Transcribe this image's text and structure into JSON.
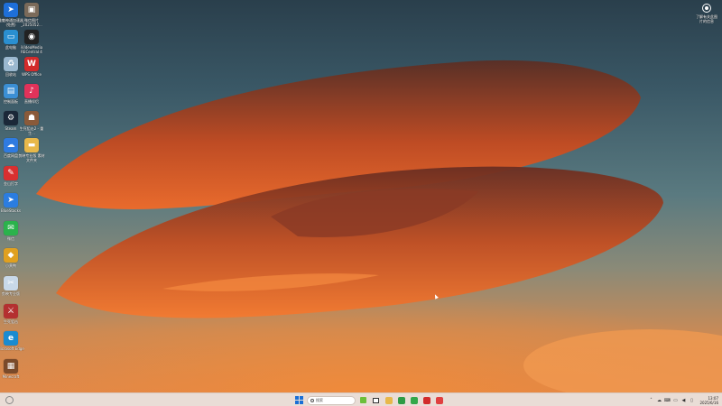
{
  "desktop": {
    "icons": [
      {
        "label": "维魅神通加速器(免费)",
        "icon": "speedup-icon",
        "color": "#1e6fd9",
        "glyph": "➤"
      },
      {
        "label": "微信图片_2025052...",
        "icon": "photo-file-icon",
        "color": "#7a6a5a",
        "glyph": "▣"
      },
      {
        "label": "此电脑",
        "icon": "computer-icon",
        "color": "#2a8fd0",
        "glyph": "▭"
      },
      {
        "label": "iVideoMedia RECentral 4",
        "icon": "recorder-icon",
        "color": "#222222",
        "glyph": "◉"
      },
      {
        "label": "回收站",
        "icon": "recycle-bin-icon",
        "color": "#9ab8cf",
        "glyph": "♻"
      },
      {
        "label": "WPS Office",
        "icon": "wps-icon",
        "color": "#d22b2b",
        "glyph": "W"
      },
      {
        "label": "控制面板",
        "icon": "control-panel-icon",
        "color": "#3b8fd4",
        "glyph": "▤"
      },
      {
        "label": "直播伴侣",
        "icon": "live-companion-icon",
        "color": "#e0325a",
        "glyph": "♪"
      },
      {
        "label": "Steam",
        "icon": "steam-icon",
        "color": "#1b2838",
        "glyph": "⚙"
      },
      {
        "label": "生死狙击2 - 重生...",
        "icon": "game-icon",
        "color": "#8a5a3a",
        "glyph": "☗"
      },
      {
        "label": "百度网盘",
        "icon": "cloud-disk-icon",
        "color": "#2f7be0",
        "glyph": "☁"
      },
      {
        "label": "剪映专业版 素材文件夹",
        "icon": "folder-icon",
        "color": "#e8b84a",
        "glyph": "▬"
      },
      {
        "label": "金山打字",
        "icon": "typing-icon",
        "color": "#d83030",
        "glyph": "✎"
      },
      {
        "label": "BlueStacks",
        "icon": "bluestacks-icon",
        "color": "#2b7de0",
        "glyph": "➤"
      },
      {
        "label": "微信",
        "icon": "wechat-icon",
        "color": "#2bb24c",
        "glyph": "✉"
      },
      {
        "label": "小黄鸭",
        "icon": "duck-icon",
        "color": "#e0a020",
        "glyph": "◆"
      },
      {
        "label": "剪映专业版",
        "icon": "video-editor-icon",
        "color": "#c8d8e8",
        "glyph": "✂"
      },
      {
        "label": "生死狙击",
        "icon": "sniper-icon",
        "color": "#b43030",
        "glyph": "⚔"
      },
      {
        "label": "Microsoft Edge",
        "icon": "edge-icon",
        "color": "#1a8bd0",
        "glyph": "e"
      },
      {
        "label": "Minecraft",
        "icon": "minecraft-icon",
        "color": "#7a4a2a",
        "glyph": "▦"
      }
    ]
  },
  "widget": {
    "icon": "account-circle-icon",
    "label": "了解有关此图片的信息"
  },
  "taskbar": {
    "search_placeholder": "搜索",
    "apps": [
      {
        "name": "file-explorer-icon",
        "color": "#e8b84a"
      },
      {
        "name": "chrome-icon",
        "color": "#2e9b45"
      },
      {
        "name": "green-app-icon",
        "color": "#33a84a"
      },
      {
        "name": "wps-taskbar-icon",
        "color": "#d22b2b"
      },
      {
        "name": "record-app-icon",
        "color": "#e04040"
      }
    ],
    "clock_time": "13:07",
    "clock_date": "2025/6/16"
  }
}
